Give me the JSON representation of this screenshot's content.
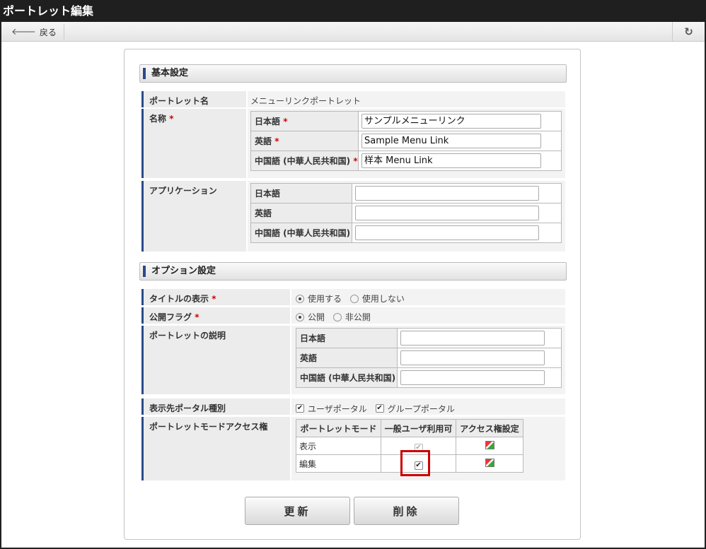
{
  "window": {
    "title": "ポートレット編集"
  },
  "toolbar": {
    "back_label": "戻る"
  },
  "sections": {
    "basic": "基本設定",
    "options": "オプション設定"
  },
  "portlet_name": {
    "label": "ポートレット名",
    "value": "メニューリンクポートレット"
  },
  "name": {
    "label": "名称",
    "required_mark": "*",
    "rows": [
      {
        "lang": "日本語",
        "value": "サンプルメニューリンク"
      },
      {
        "lang": "英語",
        "value": "Sample Menu Link"
      },
      {
        "lang": "中国語 (中華人民共和国)",
        "value": "样本 Menu Link"
      }
    ]
  },
  "application": {
    "label": "アプリケーション",
    "rows": [
      {
        "lang": "日本語",
        "value": ""
      },
      {
        "lang": "英語",
        "value": ""
      },
      {
        "lang": "中国語 (中華人民共和国)",
        "value": ""
      }
    ]
  },
  "title_display": {
    "label": "タイトルの表示",
    "opt_use": "使用する",
    "opt_nouse": "使用しない",
    "selected": "使用する"
  },
  "publish_flag": {
    "label": "公開フラグ",
    "opt_public": "公開",
    "opt_private": "非公開",
    "selected": "公開"
  },
  "description": {
    "label": "ポートレットの説明",
    "rows": [
      {
        "lang": "日本語",
        "value": ""
      },
      {
        "lang": "英語",
        "value": ""
      },
      {
        "lang": "中国語 (中華人民共和国)",
        "value": ""
      }
    ]
  },
  "portal_type": {
    "label": "表示先ポータル種別",
    "opt_user": "ユーザポータル",
    "opt_group": "グループポータル",
    "user_checked": true,
    "group_checked": true
  },
  "mode_access": {
    "label": "ポートレットモードアクセス権",
    "headers": [
      "ポートレットモード",
      "一般ユーザ利用可",
      "アクセス権設定"
    ],
    "rows": [
      {
        "mode": "表示",
        "general_user": true,
        "disabled": true
      },
      {
        "mode": "編集",
        "general_user": true,
        "disabled": false
      }
    ]
  },
  "buttons": {
    "update": "更新",
    "delete": "削除"
  }
}
